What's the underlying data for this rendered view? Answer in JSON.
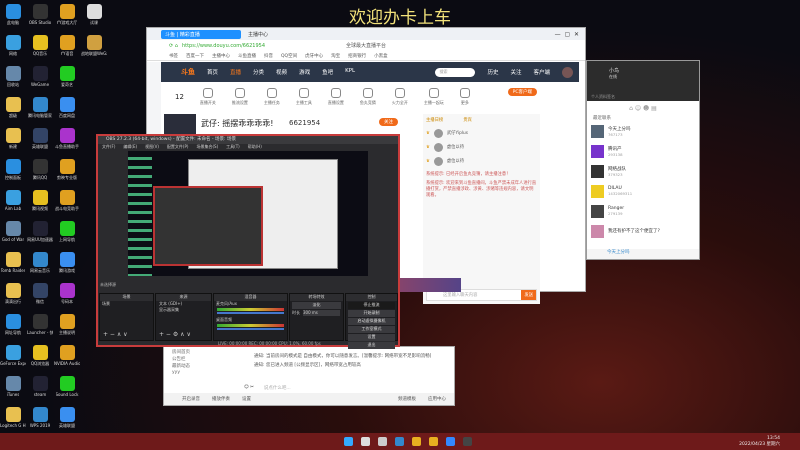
{
  "banner": "欢迎办卡上车",
  "desktop_icons": [
    "此电脑",
    "OBS Studio",
    "YY游戏大厅",
    "试课",
    "网络",
    "QQ音乐",
    "YY语音",
    "战地联盟WeGame版",
    "回收站",
    "WeGame",
    "爱奇艺",
    "",
    "超级",
    "腾讯电脑管家",
    "百度网盘",
    "",
    "新建",
    "英雄联盟",
    "斗鱼直播助手",
    "",
    "控制面板",
    "腾讯QQ",
    "剪映专业版",
    "",
    "Aim Lab",
    "腾讯视频",
    "战斗电竞助手",
    "",
    "God of War",
    "网易UU加速器",
    "上网导航",
    "",
    "Tomb Raider",
    "网易云音乐",
    "腾讯游戏",
    "",
    "滴滴出行",
    "微信",
    "号码本",
    "",
    "网址导航",
    "Launcher - 快捷方式",
    "主播说明",
    "",
    "GeForce Experience",
    "QQ浏览器",
    "NVIDIA Audio",
    "",
    "iTunes",
    "steam",
    "Sound Lock",
    "",
    "Logitech G HUB",
    "WPS 2019",
    "英雄联盟"
  ],
  "browser": {
    "tabs": [
      "斗鱼 | 精彩直播",
      "主播中心"
    ],
    "url": "https://www.douyu.com/6621954",
    "search_hint": "全球最大直播平台",
    "bookmarks": [
      "书签",
      "百度一下",
      "主播中心",
      "斗鱼直播",
      "抖音",
      "QQ空间",
      "虎牙中心",
      "淘宝",
      "招商银行",
      "小黑盒"
    ],
    "nav": {
      "logo": "斗鱼",
      "items": [
        "首页",
        "直播",
        "分类",
        "视频",
        "游戏",
        "鱼吧",
        "KPL"
      ],
      "search_placeholder": "搜索",
      "right": [
        "历史",
        "关注",
        "客户端"
      ]
    },
    "tools": {
      "count": "12",
      "items": [
        "直播开关",
        "推流设置",
        "主播任务",
        "主播工具",
        "直播设置",
        "鱼丸竞猜",
        "火力全开",
        "主播一起玩",
        "更多"
      ],
      "pc_button": "PC客户端"
    },
    "room": {
      "title": "武仔: 摇摆乖乖乖乖!",
      "room_id": "6621954",
      "follow": "关注"
    },
    "chat": {
      "tabs": [
        "主播日榜",
        "贵宾"
      ],
      "ranks": [
        "武仔Yiplus",
        "虚位以待",
        "虚位以待"
      ],
      "notices": [
        "系统提示: 已经开启鱼丸竞猜，请主播注意！",
        "系统提示: 欢迎来到斗鱼直播间，斗鱼严禁未成年人进行直播打赏，严禁直播涉政、涉黄、涉赌等违规内容，请文明观看。"
      ],
      "input_placeholder": "这里输入聊天内容",
      "send": "发送"
    }
  },
  "obs": {
    "title": "OBS 27.2.3 (64-bit, windows) - 配置文件: 未命名 - 场景: 场景",
    "menu": [
      "文件(F)",
      "编辑(E)",
      "视图(V)",
      "配置文件(P)",
      "场景集合(S)",
      "工具(T)",
      "帮助(H)"
    ],
    "no_source": "未选择源",
    "docks": {
      "scenes": "场景",
      "sources": "来源",
      "mixer": "混音器",
      "transitions": "转场特效",
      "controls": "控制"
    },
    "scene_items": [
      "场景"
    ],
    "sources": [
      "文本 (GDI+)",
      "显示器采集"
    ],
    "mixer": [
      "麦克风/Aux",
      "桌面音频"
    ],
    "transition": "淡化",
    "duration_label": "时长",
    "duration": "300 ms",
    "controls": [
      "停止推流",
      "开始录制",
      "启动虚拟摄像机",
      "工作室模式",
      "设置",
      "退出"
    ],
    "status": "LIVE: 00:00:00  REC: 00:00:00  CPU: 1.0%, 60.00 fps"
  },
  "yy": {
    "channels": [
      "房间首页",
      "公告栏",
      "最新动态",
      "yyy"
    ],
    "messages": [
      "通知: 当前房间的模式是 自由模式，你可以随意发言。[温馨提示: 网络带宽不足影响流畅]",
      "通知: 您已进入频道 [公频显示区]，网络带宽占用较高"
    ],
    "input_placeholder": "说点什么吧...",
    "toolbar": [
      "开启录音",
      "播放伴奏",
      "设置"
    ],
    "right": [
      "频道模板",
      "应用中心"
    ]
  },
  "qq": {
    "name": "小鸟",
    "status": "在线",
    "signature": "个人资料签名",
    "section": "最近联系",
    "contacts": [
      {
        "name": "今天上分吗",
        "meta": "767173"
      },
      {
        "name": "腾讯产",
        "meta": "293138"
      },
      {
        "name": "网络战队",
        "meta": "379323"
      },
      {
        "name": "DILAU",
        "meta": "1432069311"
      },
      {
        "name": "Ranger",
        "meta": "279139"
      },
      {
        "name": "我还有护不了这个便宜了?",
        "meta": ""
      }
    ],
    "footer": "今天上分吗"
  },
  "taskbar": {
    "time": "13:54",
    "date": "2022/04/23 星期六"
  }
}
